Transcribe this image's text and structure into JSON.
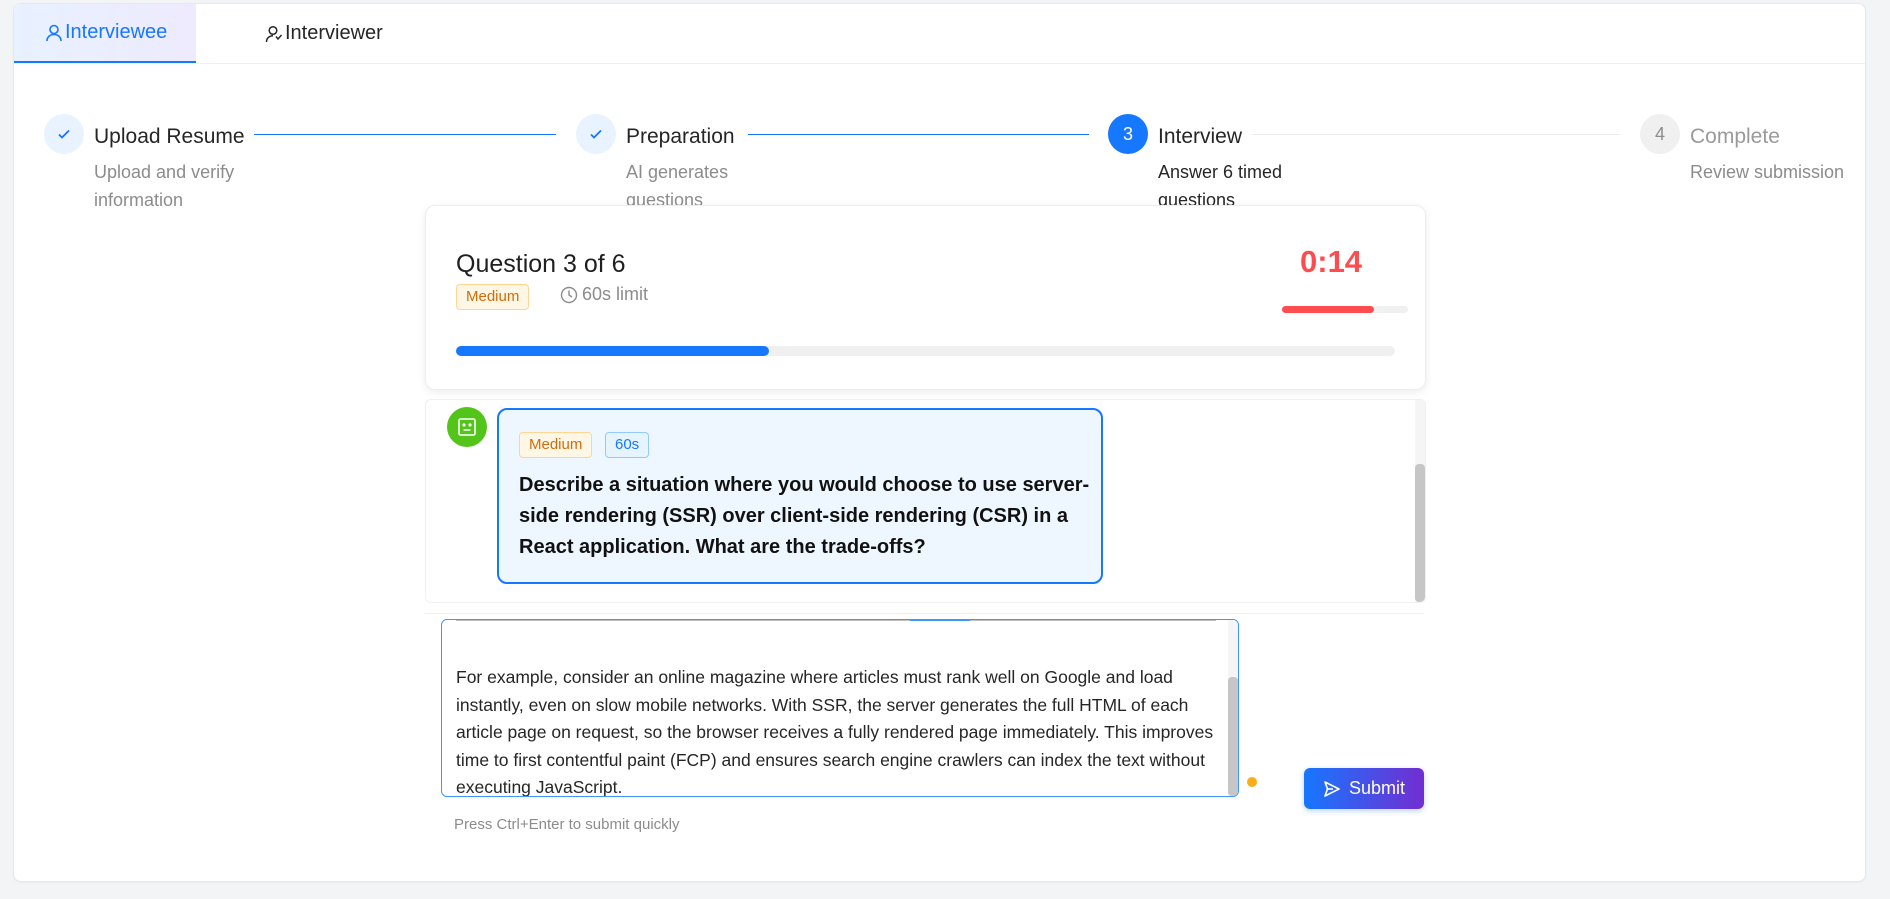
{
  "tabs": [
    {
      "label": "Interviewee",
      "icon": "user-icon",
      "active": true
    },
    {
      "label": "Interviewer",
      "icon": "team-icon",
      "active": false
    }
  ],
  "steps": [
    {
      "title": "Upload Resume",
      "desc": "Upload and verify information",
      "status": "done"
    },
    {
      "title": "Preparation",
      "desc": "AI generates questions",
      "status": "done"
    },
    {
      "title": "Interview",
      "desc": "Answer 6 timed questions",
      "status": "current",
      "number": "3"
    },
    {
      "title": "Complete",
      "desc": "Review submission",
      "status": "pending",
      "number": "4"
    }
  ],
  "question_card": {
    "title": "Question 3 of 6",
    "difficulty": "Medium",
    "limit": "60s limit",
    "timer": "0:14",
    "timer_fraction": 0.73,
    "progress_fraction": 0.333
  },
  "chat": {
    "difficulty": "Medium",
    "time_tag": "60s",
    "question": "Describe a situation where you would choose to use server-side rendering (SSR) over client-side rendering (CSR) in a React application. What are the trade-offs?"
  },
  "answer": {
    "text": "For example, consider an online magazine where articles must rank well on Google and load instantly, even on slow mobile networks. With SSR, the server generates the full HTML of each article page on request, so the browser receives a fully rendered page immediately. This improves time to first contentful paint (FCP) and ensures search engine crawlers can index the text without executing JavaScript."
  },
  "submit_label": "Submit",
  "hint": "Press Ctrl+Enter to submit quickly",
  "colors": {
    "primary": "#1677ff",
    "danger": "#ff4d4f",
    "success": "#52c41a",
    "warning": "#faad14"
  }
}
